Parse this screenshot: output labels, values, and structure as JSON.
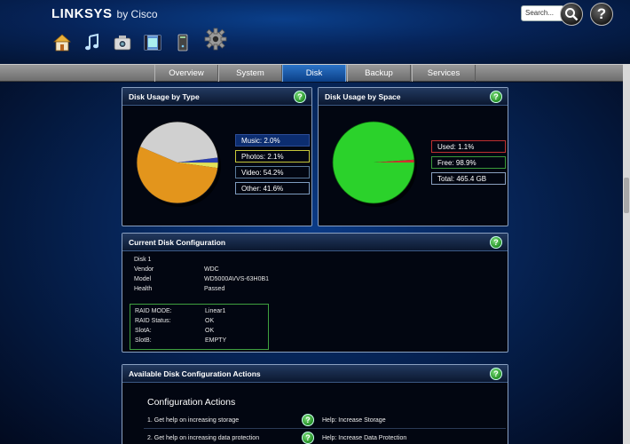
{
  "header": {
    "brand": "LINKSYS",
    "brand_suffix": "by Cisco",
    "search_placeholder": "Search...",
    "help_label": "?",
    "app_icons": [
      "home-icon",
      "music-icon",
      "photos-icon",
      "video-icon",
      "storage-icon",
      "settings-gear-icon"
    ]
  },
  "tabs": [
    {
      "label": "Overview",
      "active": false
    },
    {
      "label": "System",
      "active": false
    },
    {
      "label": "Disk",
      "active": true
    },
    {
      "label": "Backup",
      "active": false
    },
    {
      "label": "Services",
      "active": false
    }
  ],
  "disk_usage_type": {
    "title": "Disk Usage by Type",
    "legend": {
      "music": "Music: 2.0%",
      "photos": "Photos: 2.1%",
      "video": "Video: 54.2%",
      "other": "Other: 41.6%"
    }
  },
  "disk_usage_space": {
    "title": "Disk Usage by Space",
    "legend": {
      "used": "Used: 1.1%",
      "free": "Free: 98.9%",
      "total": "Total: 465.4 GB"
    }
  },
  "current_config": {
    "title": "Current Disk Configuration",
    "disk_label": "Disk 1",
    "rows": [
      {
        "label": "Vendor",
        "value": "WDC"
      },
      {
        "label": "Model",
        "value": "WD5000AVVS-63H0B1"
      },
      {
        "label": "Health",
        "value": "Passed"
      }
    ],
    "raid": [
      {
        "label": "RAID MODE:",
        "value": "Linear1"
      },
      {
        "label": "RAID Status:",
        "value": "OK"
      },
      {
        "label": "SlotA:",
        "value": "OK"
      },
      {
        "label": "SlotB:",
        "value": "EMPTY"
      }
    ]
  },
  "actions": {
    "title": "Available Disk Configuration Actions",
    "subtitle": "Configuration Actions",
    "items": [
      {
        "label": "1. Get help on increasing storage",
        "help": "Help: Increase Storage"
      },
      {
        "label": "2. Get help on increasing data protection",
        "help": "Help: Increase Data Protection"
      }
    ]
  },
  "chart_data": [
    {
      "type": "pie",
      "title": "Disk Usage by Type",
      "categories": [
        "Music",
        "Photos",
        "Video",
        "Other"
      ],
      "values": [
        2.0,
        2.1,
        54.2,
        41.6
      ],
      "colors": [
        "#2c3fb0",
        "#e2e25a",
        "#e3951c",
        "#d0d0d0"
      ]
    },
    {
      "type": "pie",
      "title": "Disk Usage by Space",
      "categories": [
        "Used",
        "Free"
      ],
      "values": [
        1.1,
        98.9
      ],
      "colors": [
        "#d23030",
        "#2bd22b"
      ],
      "total": "465.4 GB"
    }
  ]
}
